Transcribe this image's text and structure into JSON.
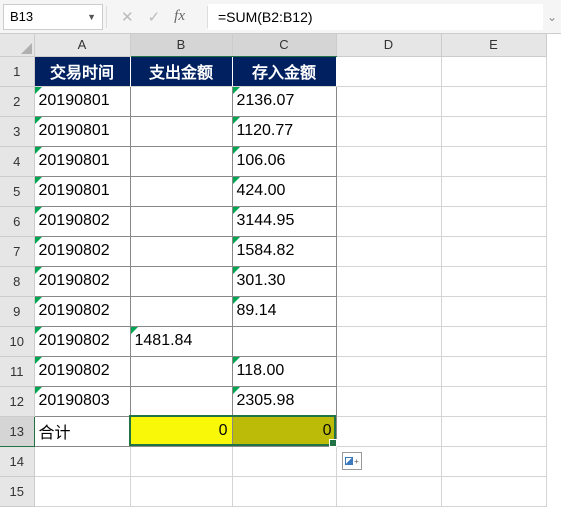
{
  "formula_bar": {
    "name_box": "B13",
    "fx_label": "fx",
    "formula": "=SUM(B2:B12)"
  },
  "columns": [
    "A",
    "B",
    "C",
    "D",
    "E"
  ],
  "rows_visible": 15,
  "headers": {
    "A": "交易时间",
    "B": "支出金额",
    "C": "存入金额"
  },
  "data_rows": [
    {
      "A": "20190801",
      "B": "",
      "C": "2136.07"
    },
    {
      "A": "20190801",
      "B": "",
      "C": "1120.77"
    },
    {
      "A": "20190801",
      "B": "",
      "C": "106.06"
    },
    {
      "A": "20190801",
      "B": "",
      "C": "424.00"
    },
    {
      "A": "20190802",
      "B": "",
      "C": "3144.95"
    },
    {
      "A": "20190802",
      "B": "",
      "C": "1584.82"
    },
    {
      "A": "20190802",
      "B": "",
      "C": "301.30"
    },
    {
      "A": "20190802",
      "B": "",
      "C": "89.14"
    },
    {
      "A": "20190802",
      "B": "1481.84",
      "C": ""
    },
    {
      "A": "20190802",
      "B": "",
      "C": "118.00"
    },
    {
      "A": "20190803",
      "B": "",
      "C": "2305.98"
    }
  ],
  "total_row": {
    "label": "合计",
    "B": "0",
    "C": "0"
  },
  "selected_columns": [
    "B",
    "C"
  ],
  "selected_row": 13
}
